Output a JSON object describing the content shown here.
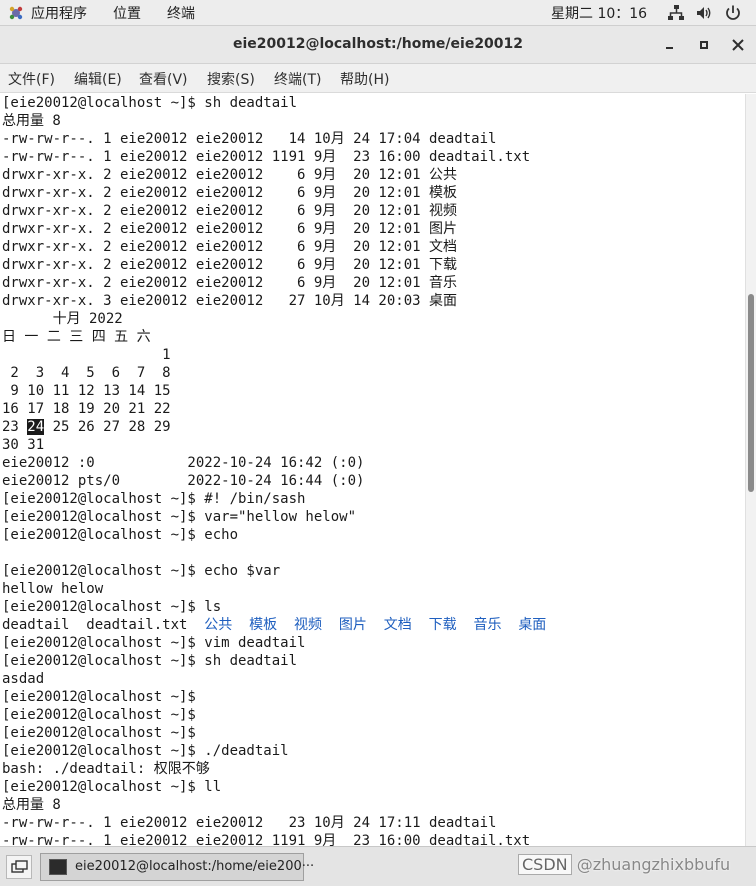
{
  "topbar": {
    "applications": "应用程序",
    "places": "位置",
    "terminal": "终端",
    "clock": "星期二 10：16"
  },
  "window": {
    "title": "eie20012@localhost:/home/eie20012"
  },
  "menubar": {
    "file": "文件(F)",
    "edit": "编辑(E)",
    "view": "查看(V)",
    "search": "搜索(S)",
    "terminal": "终端(T)",
    "help": "帮助(H)"
  },
  "terminal": {
    "lines": [
      "[eie20012@localhost ~]$ sh deadtail",
      "总用量 8",
      "-rw-rw-r--. 1 eie20012 eie20012   14 10月 24 17:04 deadtail",
      "-rw-rw-r--. 1 eie20012 eie20012 1191 9月  23 16:00 deadtail.txt",
      "drwxr-xr-x. 2 eie20012 eie20012    6 9月  20 12:01 公共",
      "drwxr-xr-x. 2 eie20012 eie20012    6 9月  20 12:01 模板",
      "drwxr-xr-x. 2 eie20012 eie20012    6 9月  20 12:01 视频",
      "drwxr-xr-x. 2 eie20012 eie20012    6 9月  20 12:01 图片",
      "drwxr-xr-x. 2 eie20012 eie20012    6 9月  20 12:01 文档",
      "drwxr-xr-x. 2 eie20012 eie20012    6 9月  20 12:01 下载",
      "drwxr-xr-x. 2 eie20012 eie20012    6 9月  20 12:01 音乐",
      "drwxr-xr-x. 3 eie20012 eie20012   27 10月 14 20:03 桌面",
      "      十月 2022",
      "日 一 二 三 四 五 六",
      "                   1",
      " 2  3  4  5  6  7  8",
      " 9 10 11 12 13 14 15",
      "16 17 18 19 20 21 22",
      null,
      "30 31",
      "eie20012 :0           2022-10-24 16:42 (:0)",
      "eie20012 pts/0        2022-10-24 16:44 (:0)",
      "[eie20012@localhost ~]$ #! /bin/sash",
      "[eie20012@localhost ~]$ var=\"hellow helow\"",
      "[eie20012@localhost ~]$ echo",
      "",
      "[eie20012@localhost ~]$ echo $var",
      "hellow helow",
      "[eie20012@localhost ~]$ ls",
      null,
      "[eie20012@localhost ~]$ vim deadtail",
      "[eie20012@localhost ~]$ sh deadtail",
      "asdad",
      "[eie20012@localhost ~]$",
      "[eie20012@localhost ~]$",
      "[eie20012@localhost ~]$",
      "[eie20012@localhost ~]$ ./deadtail",
      "bash: ./deadtail: 权限不够",
      "[eie20012@localhost ~]$ ll",
      "总用量 8",
      "-rw-rw-r--. 1 eie20012 eie20012   23 10月 24 17:11 deadtail",
      "-rw-rw-r--. 1 eie20012 eie20012 1191 9月  23 16:00 deadtail.txt"
    ],
    "calendar_row_today": {
      "before": "23 ",
      "today": "24",
      "after": " 25 26 27 28 29"
    },
    "ls_output": {
      "files": "deadtail  deadtail.txt  ",
      "dirs": [
        "公共",
        "模板",
        "视频",
        "图片",
        "文档",
        "下载",
        "音乐",
        "桌面"
      ]
    }
  },
  "taskbar": {
    "window_item": "eie20012@localhost:/home/eie200···",
    "watermark_csdn": "CSDN",
    "watermark_user": " @zhuangzhixbbufu"
  },
  "colors": {
    "directory": "#1f5fbf",
    "terminal_text": "#1a1a1a",
    "terminal_bg": "#ffffff"
  }
}
